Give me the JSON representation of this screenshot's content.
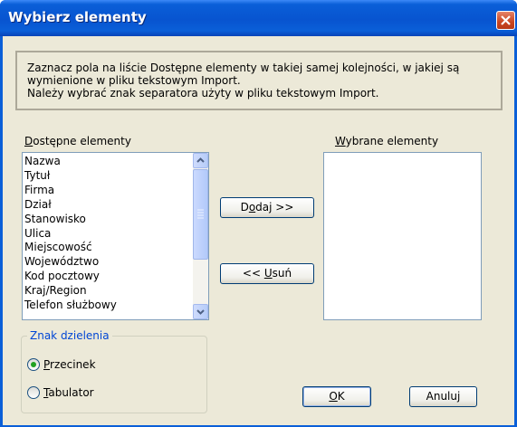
{
  "window": {
    "title": "Wybierz elementy",
    "close_icon": "close-icon"
  },
  "info": {
    "line1": "Zaznacz pola na liście Dostępne elementy w takiej samej kolejności, w jakiej są",
    "line2": "wymienione w pliku tekstowym Import.",
    "line3": "Należy wybrać znak separatora użyty w pliku tekstowym Import."
  },
  "available": {
    "label": "Dostępne elementy",
    "items": [
      "Nazwa",
      "Tytuł",
      "Firma",
      "Dział",
      "Stanowisko",
      "Ulica",
      "Miejscowość",
      "Województwo",
      "Kod pocztowy",
      "Kraj/Region",
      "Telefon służbowy"
    ]
  },
  "selected": {
    "label": "Wybrane elementy",
    "items": []
  },
  "buttons": {
    "add": "Dodaj >>",
    "remove": "<< Usuń",
    "ok": "OK",
    "cancel": "Anuluj"
  },
  "separator": {
    "legend": "Znak dzielenia",
    "options": [
      "Przecinek",
      "Tabulator"
    ],
    "selected": "Przecinek"
  },
  "colors": {
    "titlebar": "#0a5fd8",
    "dialog_bg": "#ece9d8",
    "group_legend": "#0046d5",
    "radio_dot": "#21a121"
  }
}
